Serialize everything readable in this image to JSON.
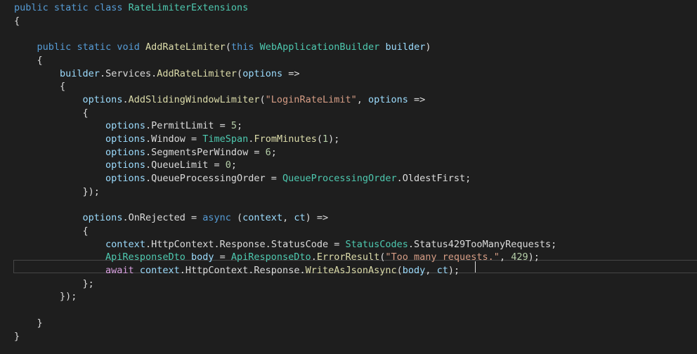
{
  "editor": {
    "lines": [
      [
        {
          "t": "public",
          "c": "kw"
        },
        {
          "t": " "
        },
        {
          "t": "static",
          "c": "kw"
        },
        {
          "t": " "
        },
        {
          "t": "class",
          "c": "kw"
        },
        {
          "t": " "
        },
        {
          "t": "RateLimiterExtensions",
          "c": "type"
        }
      ],
      [
        {
          "t": "{"
        }
      ],
      [],
      [
        {
          "t": "    "
        },
        {
          "t": "public",
          "c": "kw"
        },
        {
          "t": " "
        },
        {
          "t": "static",
          "c": "kw"
        },
        {
          "t": " "
        },
        {
          "t": "void",
          "c": "kw"
        },
        {
          "t": " "
        },
        {
          "t": "AddRateLimiter",
          "c": "method"
        },
        {
          "t": "("
        },
        {
          "t": "this",
          "c": "kw"
        },
        {
          "t": " "
        },
        {
          "t": "WebApplicationBuilder",
          "c": "type"
        },
        {
          "t": " "
        },
        {
          "t": "builder",
          "c": "id"
        },
        {
          "t": ")"
        }
      ],
      [
        {
          "t": "    {"
        }
      ],
      [
        {
          "t": "        "
        },
        {
          "t": "builder",
          "c": "id"
        },
        {
          "t": "."
        },
        {
          "t": "Services",
          "c": "prop"
        },
        {
          "t": "."
        },
        {
          "t": "AddRateLimiter",
          "c": "method"
        },
        {
          "t": "("
        },
        {
          "t": "options",
          "c": "id"
        },
        {
          "t": " =>"
        }
      ],
      [
        {
          "t": "        {"
        }
      ],
      [
        {
          "t": "            "
        },
        {
          "t": "options",
          "c": "id"
        },
        {
          "t": "."
        },
        {
          "t": "AddSlidingWindowLimiter",
          "c": "method"
        },
        {
          "t": "("
        },
        {
          "t": "\"LoginRateLimit\"",
          "c": "str"
        },
        {
          "t": ", "
        },
        {
          "t": "options",
          "c": "id"
        },
        {
          "t": " =>"
        }
      ],
      [
        {
          "t": "            {"
        }
      ],
      [
        {
          "t": "                "
        },
        {
          "t": "options",
          "c": "id"
        },
        {
          "t": "."
        },
        {
          "t": "PermitLimit",
          "c": "prop"
        },
        {
          "t": " = "
        },
        {
          "t": "5",
          "c": "num"
        },
        {
          "t": ";"
        }
      ],
      [
        {
          "t": "                "
        },
        {
          "t": "options",
          "c": "id"
        },
        {
          "t": "."
        },
        {
          "t": "Window",
          "c": "prop"
        },
        {
          "t": " = "
        },
        {
          "t": "TimeSpan",
          "c": "type"
        },
        {
          "t": "."
        },
        {
          "t": "FromMinutes",
          "c": "method"
        },
        {
          "t": "("
        },
        {
          "t": "1",
          "c": "num"
        },
        {
          "t": ");"
        }
      ],
      [
        {
          "t": "                "
        },
        {
          "t": "options",
          "c": "id"
        },
        {
          "t": "."
        },
        {
          "t": "SegmentsPerWindow",
          "c": "prop"
        },
        {
          "t": " = "
        },
        {
          "t": "6",
          "c": "num"
        },
        {
          "t": ";"
        }
      ],
      [
        {
          "t": "                "
        },
        {
          "t": "options",
          "c": "id"
        },
        {
          "t": "."
        },
        {
          "t": "QueueLimit",
          "c": "prop"
        },
        {
          "t": " = "
        },
        {
          "t": "0",
          "c": "num"
        },
        {
          "t": ";"
        }
      ],
      [
        {
          "t": "                "
        },
        {
          "t": "options",
          "c": "id"
        },
        {
          "t": "."
        },
        {
          "t": "QueueProcessingOrder",
          "c": "prop"
        },
        {
          "t": " = "
        },
        {
          "t": "QueueProcessingOrder",
          "c": "type"
        },
        {
          "t": "."
        },
        {
          "t": "OldestFirst",
          "c": "prop"
        },
        {
          "t": ";"
        }
      ],
      [
        {
          "t": "            });"
        }
      ],
      [],
      [
        {
          "t": "            "
        },
        {
          "t": "options",
          "c": "id"
        },
        {
          "t": "."
        },
        {
          "t": "OnRejected",
          "c": "prop"
        },
        {
          "t": " = "
        },
        {
          "t": "async",
          "c": "kw"
        },
        {
          "t": " ("
        },
        {
          "t": "context",
          "c": "id"
        },
        {
          "t": ", "
        },
        {
          "t": "ct",
          "c": "id"
        },
        {
          "t": ") =>"
        }
      ],
      [
        {
          "t": "            {"
        }
      ],
      [
        {
          "t": "                "
        },
        {
          "t": "context",
          "c": "id"
        },
        {
          "t": "."
        },
        {
          "t": "HttpContext",
          "c": "prop"
        },
        {
          "t": "."
        },
        {
          "t": "Response",
          "c": "prop"
        },
        {
          "t": "."
        },
        {
          "t": "StatusCode",
          "c": "prop"
        },
        {
          "t": " = "
        },
        {
          "t": "StatusCodes",
          "c": "type"
        },
        {
          "t": "."
        },
        {
          "t": "Status429TooManyRequests",
          "c": "prop"
        },
        {
          "t": ";"
        }
      ],
      [
        {
          "t": "                "
        },
        {
          "t": "ApiResponseDto",
          "c": "type"
        },
        {
          "t": " "
        },
        {
          "t": "body",
          "c": "id"
        },
        {
          "t": " = "
        },
        {
          "t": "ApiResponseDto",
          "c": "type"
        },
        {
          "t": "."
        },
        {
          "t": "ErrorResult",
          "c": "method"
        },
        {
          "t": "("
        },
        {
          "t": "\"Too many requests.\"",
          "c": "str"
        },
        {
          "t": ", "
        },
        {
          "t": "429",
          "c": "num"
        },
        {
          "t": ");"
        }
      ],
      [
        {
          "t": "                "
        },
        {
          "t": "await",
          "c": "ctl"
        },
        {
          "t": " "
        },
        {
          "t": "context",
          "c": "id"
        },
        {
          "t": "."
        },
        {
          "t": "HttpContext",
          "c": "prop"
        },
        {
          "t": "."
        },
        {
          "t": "Response",
          "c": "prop"
        },
        {
          "t": "."
        },
        {
          "t": "WriteAsJsonAsync",
          "c": "method"
        },
        {
          "t": "("
        },
        {
          "t": "body",
          "c": "id"
        },
        {
          "t": ", "
        },
        {
          "t": "ct",
          "c": "id"
        },
        {
          "t": ");"
        }
      ],
      [
        {
          "t": "            };"
        }
      ],
      [
        {
          "t": "        });"
        }
      ],
      [],
      [
        {
          "t": "    }"
        }
      ],
      [
        {
          "t": "}"
        }
      ]
    ]
  },
  "colors": {
    "background": "#1e1e1e",
    "keyword": "#569cd6",
    "control_keyword": "#d8a0df",
    "type": "#4ec9b0",
    "identifier": "#9cdcfe",
    "method": "#dcdcaa",
    "string": "#d69d85",
    "number": "#b5cea8",
    "default_text": "#dcdcdc",
    "current_line_border": "#464646"
  }
}
